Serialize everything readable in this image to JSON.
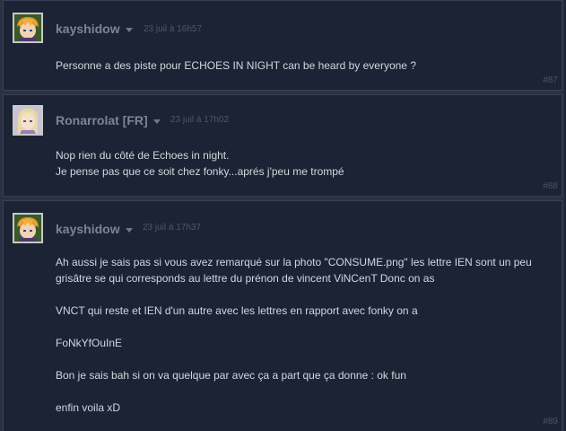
{
  "posts": [
    {
      "author": "kayshidow",
      "date": "23 juil à 16h57",
      "lines": [
        "Personne a des piste pour ECHOES IN NIGHT can be heard by everyone ?"
      ],
      "number": "#87",
      "avatar_icon": "anime-boy-avatar-icon"
    },
    {
      "author": "Ronarrolat [FR]",
      "date": "23 juil à 17h02",
      "lines": [
        "Nop rien du côté de Echoes in night.",
        "Je pense pas que ce soit chez fonky...aprés j'peu me trompé"
      ],
      "number": "#88",
      "avatar_icon": "anime-girl-avatar-icon"
    },
    {
      "author": "kayshidow",
      "date": "23 juil à 17h37",
      "paragraphs": [
        "Ah aussi je sais pas si vous avez remarqué sur la photo \"CONSUME.png\" les lettre IEN sont un peu grisâtre se qui corresponds au lettre du prénon de vincent ViNCenT Donc on as",
        "VNCT qui reste et IEN d'un autre avec les lettres en rapport avec fonky on a",
        "FoNkYfOuInE",
        "Bon je sais bah si on va quelque par avec ça a part que ça donne : ok fun",
        "enfin voila xD"
      ],
      "number": "#89",
      "avatar_icon": "anime-boy-avatar-icon"
    }
  ],
  "colors": {
    "page_bg": "#2b3142",
    "post_bg": "#1c2335",
    "author": "#7d8497",
    "text": "#d4d6dc",
    "date": "#4f566a"
  }
}
